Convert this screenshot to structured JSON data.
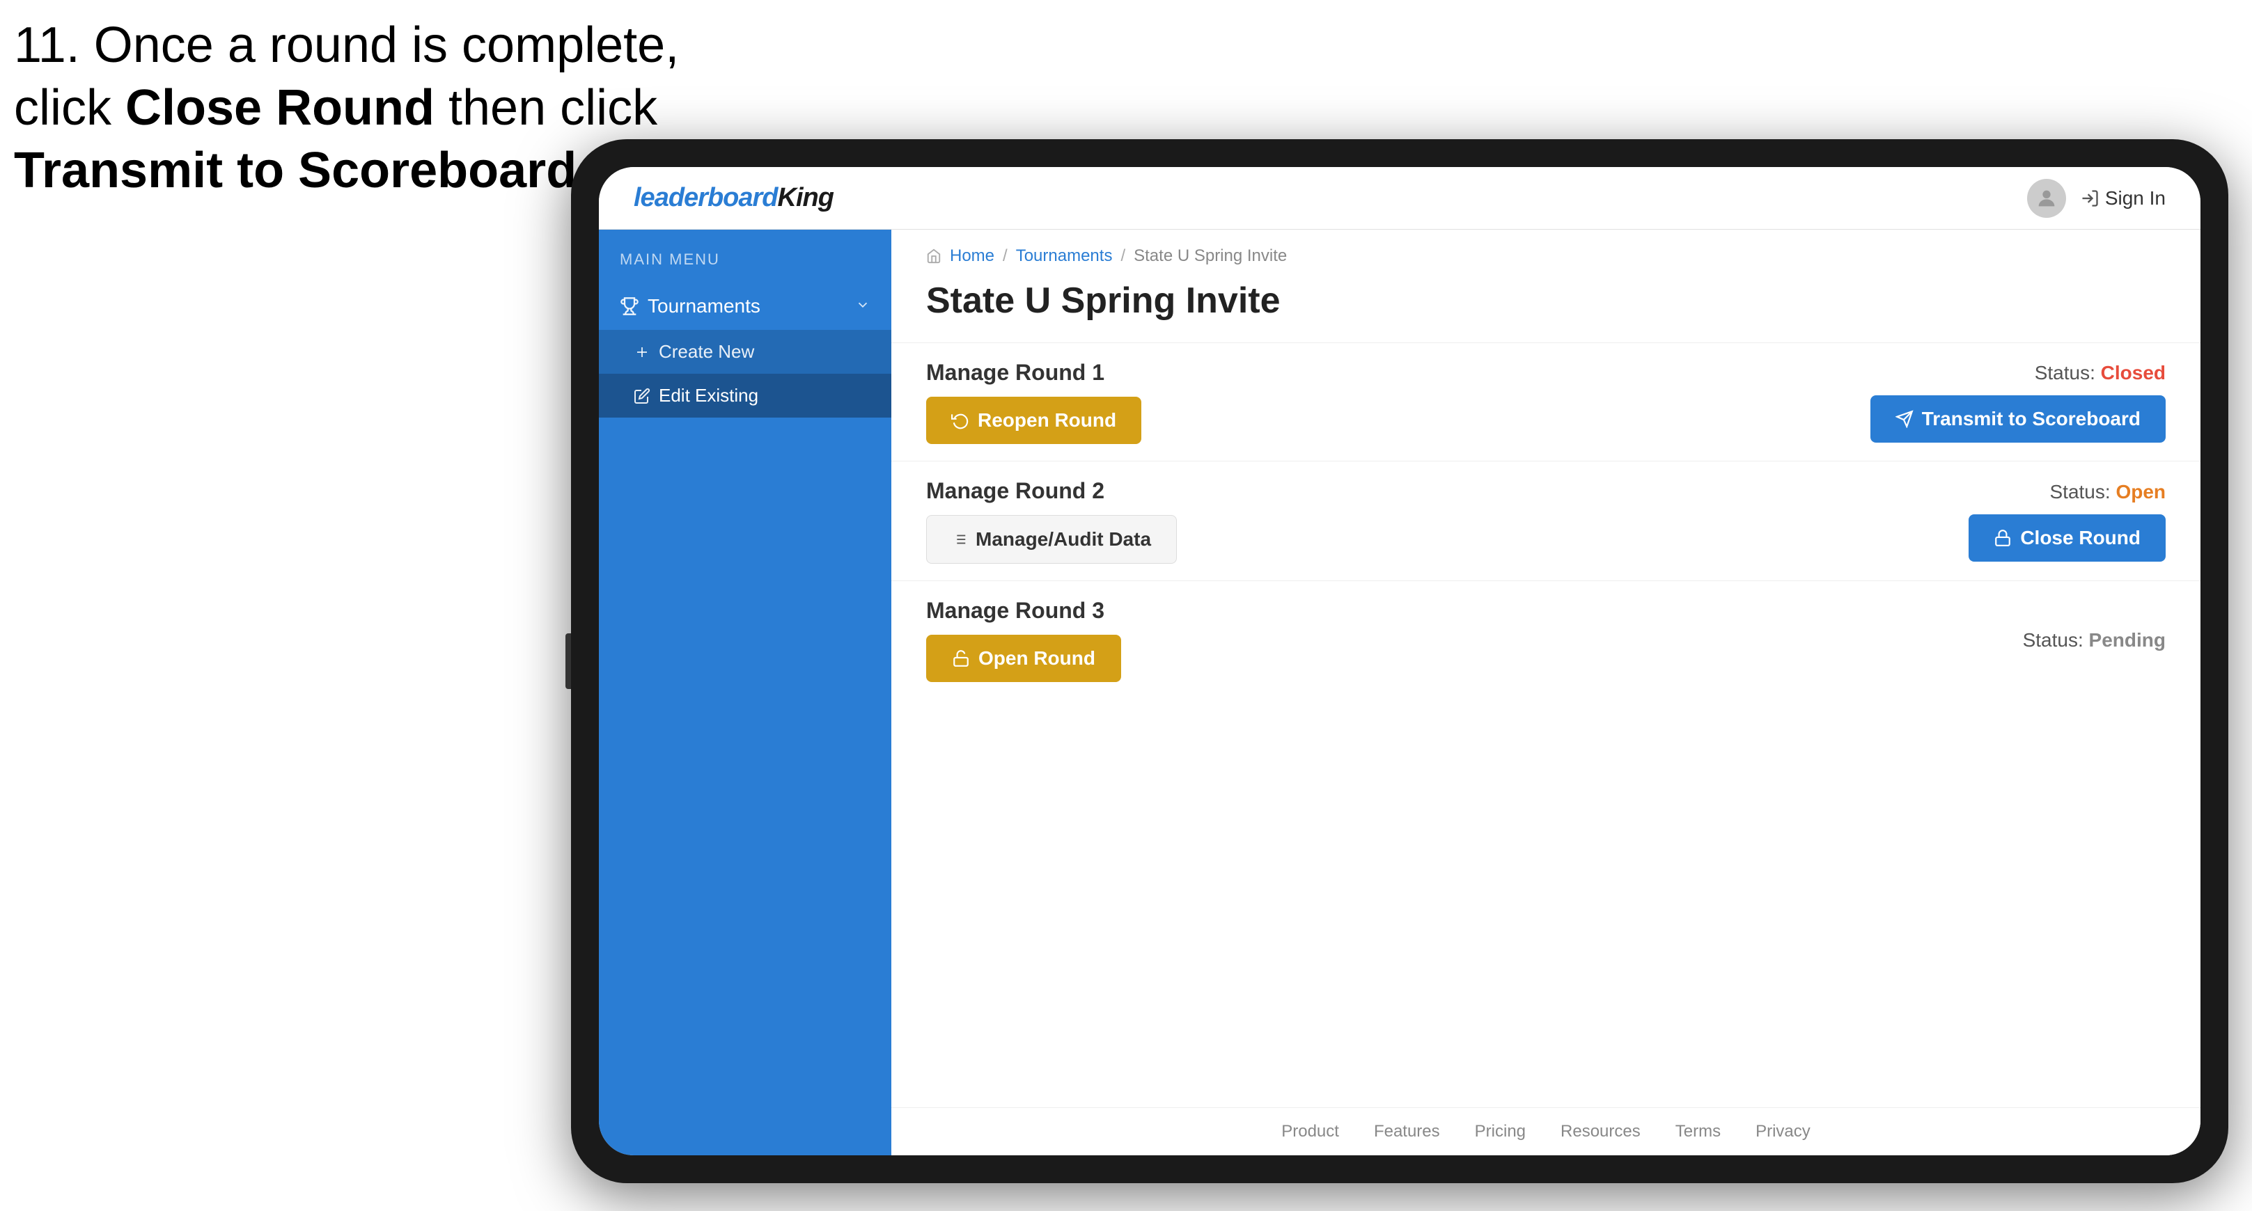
{
  "instruction": {
    "line1": "11. Once a round is complete,",
    "line2": "click ",
    "bold1": "Close Round",
    "line3": " then click",
    "line4": "",
    "bold2": "Transmit to Scoreboard."
  },
  "header": {
    "logo_leaderboard": "leaderboard",
    "logo_king": "King",
    "sign_in": "Sign In"
  },
  "sidebar": {
    "main_menu_label": "MAIN MENU",
    "items": [
      {
        "label": "Tournaments",
        "icon": "trophy-icon",
        "has_submenu": true
      },
      {
        "label": "Create New",
        "icon": "plus-icon",
        "sub": true
      },
      {
        "label": "Edit Existing",
        "icon": "edit-icon",
        "sub": true,
        "active": true
      }
    ]
  },
  "breadcrumb": {
    "home": "Home",
    "tournaments": "Tournaments",
    "current": "State U Spring Invite"
  },
  "page": {
    "title": "State U Spring Invite"
  },
  "rounds": [
    {
      "title": "Manage Round 1",
      "status_label": "Status:",
      "status_value": "Closed",
      "status_type": "closed",
      "buttons": [
        {
          "label": "Reopen Round",
          "type": "gold",
          "icon": "refresh-icon"
        },
        {
          "label": "Transmit to Scoreboard",
          "type": "blue",
          "icon": "send-icon"
        }
      ]
    },
    {
      "title": "Manage Round 2",
      "status_label": "Status:",
      "status_value": "Open",
      "status_type": "open",
      "buttons": [
        {
          "label": "Manage/Audit Data",
          "type": "light",
          "icon": "list-icon"
        },
        {
          "label": "Close Round",
          "type": "blue",
          "icon": "lock-icon"
        }
      ]
    },
    {
      "title": "Manage Round 3",
      "status_label": "Status:",
      "status_value": "Pending",
      "status_type": "pending",
      "buttons": [
        {
          "label": "Open Round",
          "type": "gold",
          "icon": "open-icon"
        }
      ]
    }
  ],
  "footer": {
    "links": [
      "Product",
      "Features",
      "Pricing",
      "Resources",
      "Terms",
      "Privacy"
    ]
  },
  "arrow": {
    "color": "#e8194b"
  }
}
